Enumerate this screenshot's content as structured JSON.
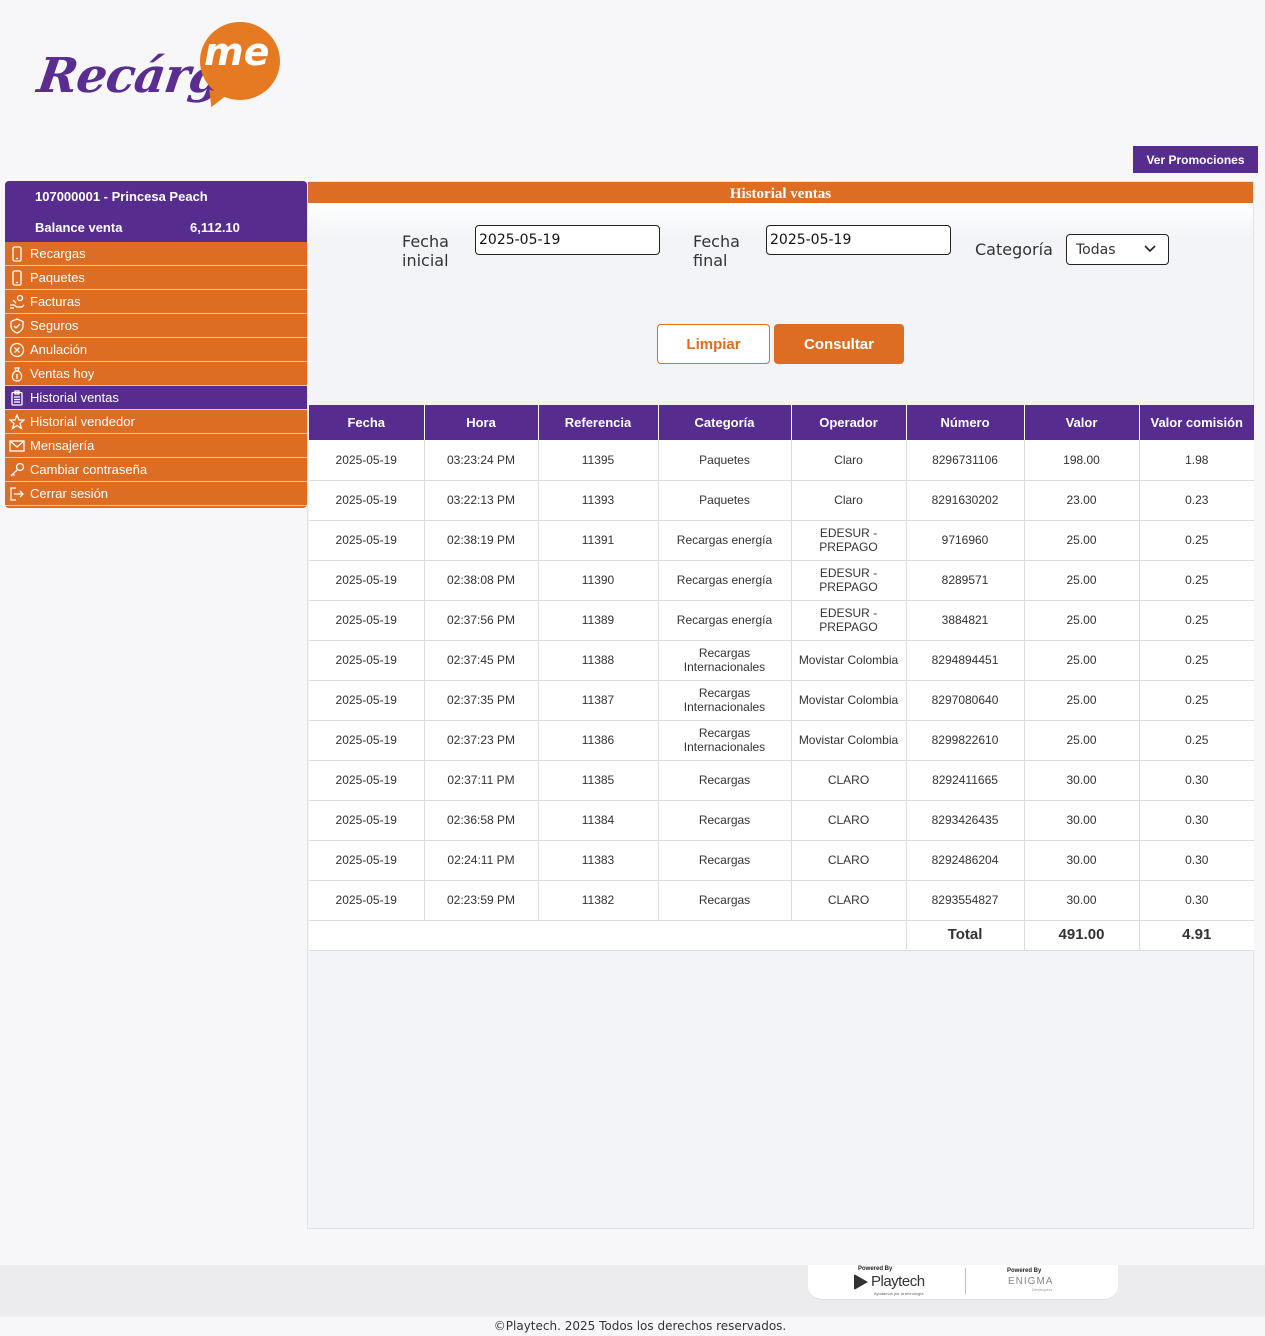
{
  "brand": {
    "logo_word": "Recárga",
    "logo_me": "me"
  },
  "header": {
    "promo_label": "Ver Promociones"
  },
  "account": {
    "user": "107000001 - Princesa Peach",
    "balance_label": "Balance venta",
    "balance_value": "6,112.10"
  },
  "menu": [
    {
      "label": "Recargas",
      "icon": "phone-icon"
    },
    {
      "label": "Paquetes",
      "icon": "phone-icon"
    },
    {
      "label": "Facturas",
      "icon": "hand-money-icon"
    },
    {
      "label": "Seguros",
      "icon": "shield-icon"
    },
    {
      "label": "Anulación",
      "icon": "cancel-circle-icon"
    },
    {
      "label": "Ventas hoy",
      "icon": "money-bag-icon"
    },
    {
      "label": "Historial ventas",
      "icon": "clipboard-icon",
      "active": true
    },
    {
      "label": "Historial vendedor",
      "icon": "star-icon"
    },
    {
      "label": "Mensajería",
      "icon": "envelope-icon"
    },
    {
      "label": "Cambiar contraseña",
      "icon": "key-icon"
    },
    {
      "label": "Cerrar sesión",
      "icon": "logout-icon"
    }
  ],
  "main": {
    "title": "Historial ventas",
    "filters": {
      "start_label_1": "Fecha",
      "start_label_2": "inicial",
      "start_value": "2025-05-19",
      "end_label_1": "Fecha",
      "end_label_2": "final",
      "end_value": "2025-05-19",
      "category_label": "Categoría",
      "category_value": "Todas"
    },
    "buttons": {
      "clear": "Limpiar",
      "query": "Consultar"
    },
    "table": {
      "headers": [
        "Fecha",
        "Hora",
        "Referencia",
        "Categoría",
        "Operador",
        "Número",
        "Valor",
        "Valor comisión"
      ],
      "rows": [
        [
          "2025-05-19",
          "03:23:24 PM",
          "11395",
          "Paquetes",
          "Claro",
          "8296731106",
          "198.00",
          "1.98"
        ],
        [
          "2025-05-19",
          "03:22:13 PM",
          "11393",
          "Paquetes",
          "Claro",
          "8291630202",
          "23.00",
          "0.23"
        ],
        [
          "2025-05-19",
          "02:38:19 PM",
          "11391",
          "Recargas energía",
          "EDESUR - PREPAGO",
          "9716960",
          "25.00",
          "0.25"
        ],
        [
          "2025-05-19",
          "02:38:08 PM",
          "11390",
          "Recargas energía",
          "EDESUR - PREPAGO",
          "8289571",
          "25.00",
          "0.25"
        ],
        [
          "2025-05-19",
          "02:37:56 PM",
          "11389",
          "Recargas energía",
          "EDESUR - PREPAGO",
          "3884821",
          "25.00",
          "0.25"
        ],
        [
          "2025-05-19",
          "02:37:45 PM",
          "11388",
          "Recargas Internacionales",
          "Movistar Colombia",
          "8294894451",
          "25.00",
          "0.25"
        ],
        [
          "2025-05-19",
          "02:37:35 PM",
          "11387",
          "Recargas Internacionales",
          "Movistar Colombia",
          "8297080640",
          "25.00",
          "0.25"
        ],
        [
          "2025-05-19",
          "02:37:23 PM",
          "11386",
          "Recargas Internacionales",
          "Movistar Colombia",
          "8299822610",
          "25.00",
          "0.25"
        ],
        [
          "2025-05-19",
          "02:37:11 PM",
          "11385",
          "Recargas",
          "CLARO",
          "8292411665",
          "30.00",
          "0.30"
        ],
        [
          "2025-05-19",
          "02:36:58 PM",
          "11384",
          "Recargas",
          "CLARO",
          "8293426435",
          "30.00",
          "0.30"
        ],
        [
          "2025-05-19",
          "02:24:11 PM",
          "11383",
          "Recargas",
          "CLARO",
          "8292486204",
          "30.00",
          "0.30"
        ],
        [
          "2025-05-19",
          "02:23:59 PM",
          "11382",
          "Recargas",
          "CLARO",
          "8293554827",
          "30.00",
          "0.30"
        ]
      ],
      "total_label": "Total",
      "total_value": "491.00",
      "total_commission": "4.91"
    }
  },
  "footer": {
    "powered_by": "Powered By",
    "brand1": "Playtech",
    "brand1_tag": "Ayudamos por la tecnología",
    "brand2": "ENIGMA",
    "brand2_tag": "Developers",
    "copyright": "©Playtech. 2025 Todos los derechos reservados."
  }
}
